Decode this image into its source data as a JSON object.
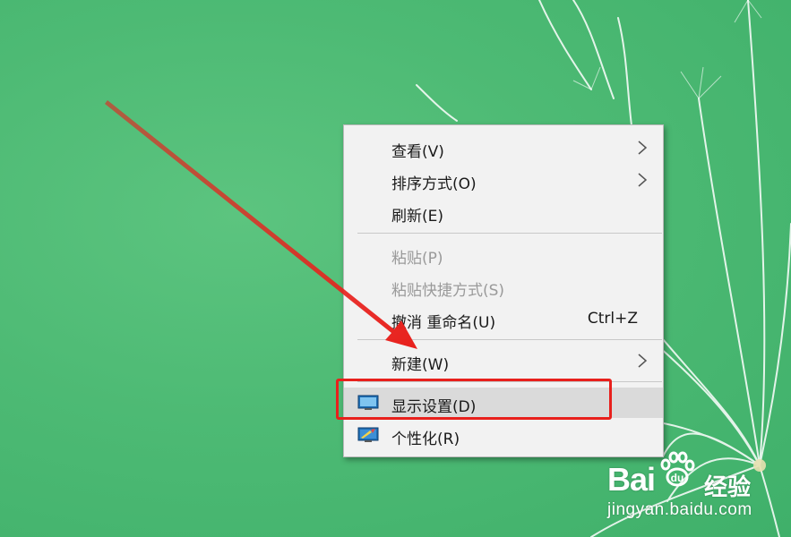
{
  "context_menu": {
    "items": [
      {
        "label": "查看(V)",
        "has_submenu": true,
        "disabled": false
      },
      {
        "label": "排序方式(O)",
        "has_submenu": true,
        "disabled": false
      },
      {
        "label": "刷新(E)",
        "has_submenu": false,
        "disabled": false
      },
      {
        "label": "粘贴(P)",
        "has_submenu": false,
        "disabled": true
      },
      {
        "label": "粘贴快捷方式(S)",
        "has_submenu": false,
        "disabled": true
      },
      {
        "label": "撤消 重命名(U)",
        "shortcut": "Ctrl+Z",
        "has_submenu": false,
        "disabled": false
      },
      {
        "label": "新建(W)",
        "has_submenu": true,
        "disabled": false
      },
      {
        "label": "显示设置(D)",
        "icon": "display-icon",
        "highlighted": true,
        "disabled": false
      },
      {
        "label": "个性化(R)",
        "icon": "personalize-icon",
        "disabled": false
      }
    ]
  },
  "annotation": {
    "highlight_color": "#e8201c",
    "highlight_target": "显示设置(D)"
  },
  "watermark": {
    "brand": "Bai",
    "brand_suffix": "经验",
    "url": "jingyan.baidu.com"
  }
}
